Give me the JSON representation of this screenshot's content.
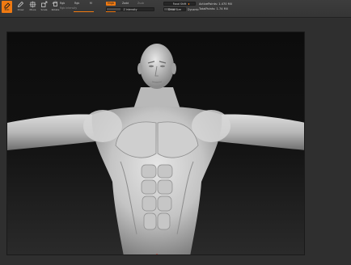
{
  "toolbar": {
    "edit_label": "Edit",
    "draw_label": "Draw",
    "move_label": "Move",
    "scale_label": "Scale",
    "rotate_label": "Rotate",
    "rgb_labels": {
      "rgb": "Rgb",
      "m": "M",
      "mrgb": "Mrgb",
      "zadd": "Zadd",
      "zsub": "Zsub"
    },
    "rgb_sub": {
      "rgb_intensity": "Rgb Intensity"
    },
    "mrgb_button": "Mrgb",
    "zadd_label": "Zadd",
    "zsub_label": "Zsub",
    "zcut_label": "Zcut",
    "z_intensity_label": "Z Intensity",
    "z_intensity_value": "0",
    "focal_shift_label": "Focal Shift",
    "focal_shift_value": "0",
    "draw_size_label": "Draw Size",
    "draw_size_value": "64",
    "dynamic_label": "Dynamic"
  },
  "stats": {
    "active_points": "ActivePoints: 1.470 Mil",
    "total_points": "TotalPoints: 1.74 Mil"
  },
  "viewport": {
    "subject": "male anatomy sculpt"
  },
  "colors": {
    "accent": "#f07a12",
    "background": "#2f2f2f",
    "toolbar": "#3a3a3a"
  },
  "icons": [
    "edit-icon",
    "draw-icon",
    "move-icon",
    "scale-icon",
    "rotate-icon"
  ]
}
